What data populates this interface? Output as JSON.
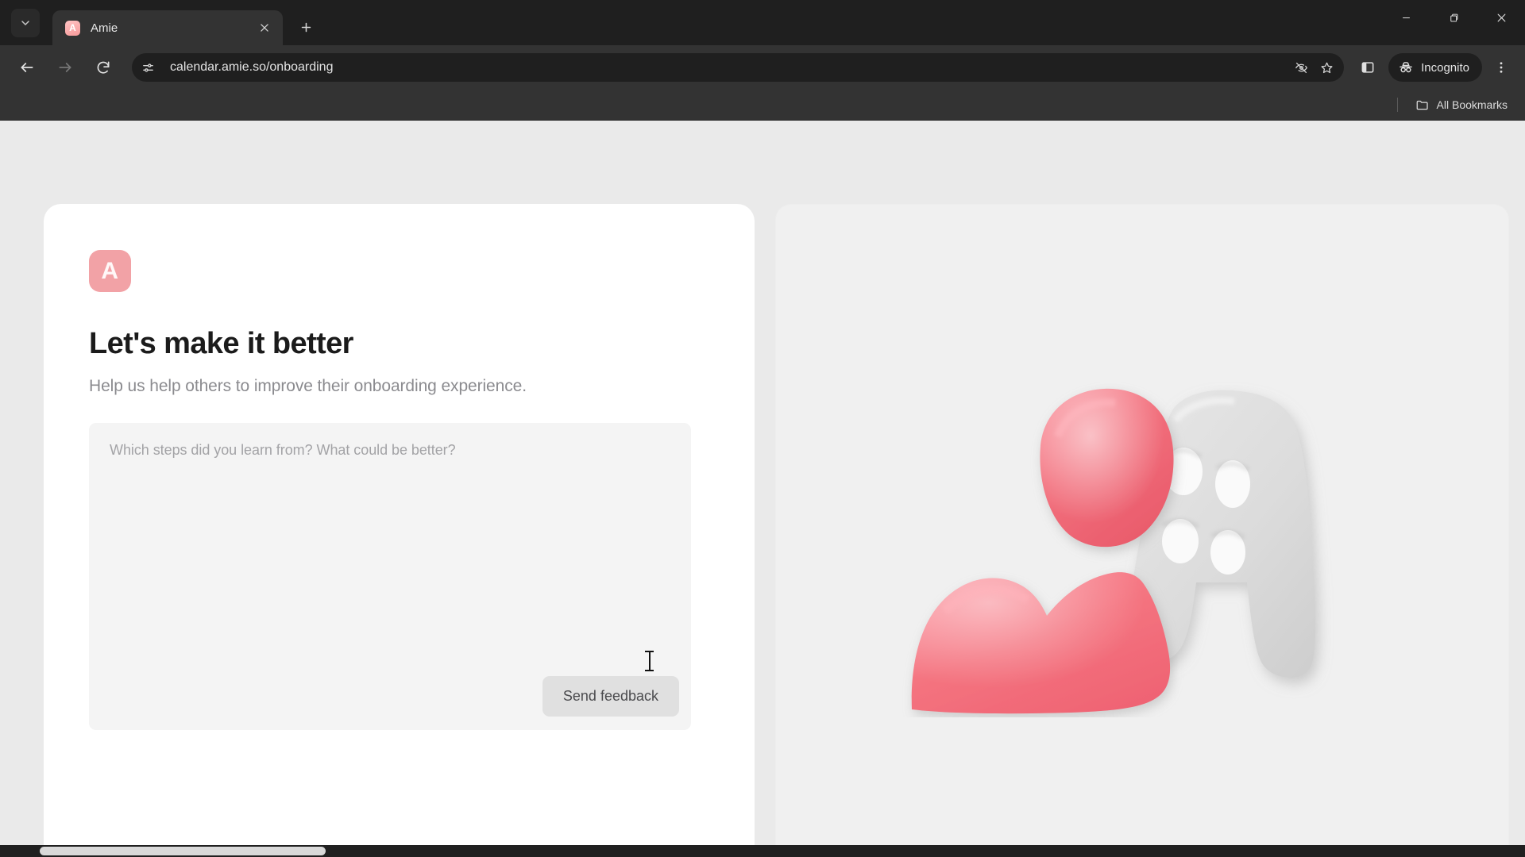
{
  "browser": {
    "tab": {
      "title": "Amie",
      "favicon_letter": "A",
      "favicon_name": "amie-favicon"
    },
    "new_tab_label": "+",
    "url": "calendar.amie.so/onboarding",
    "profile_chip": "Incognito",
    "bookmarks_label": "All Bookmarks",
    "icons": {
      "tab_search": "chevron-down-icon",
      "tab_close": "close-icon",
      "new_tab": "plus-icon",
      "back": "back-arrow-icon",
      "forward": "forward-arrow-icon",
      "reload": "reload-icon",
      "site_info": "site-settings-icon",
      "tracking": "eye-off-icon",
      "bookmark": "star-icon",
      "side_panel": "side-panel-icon",
      "incognito": "incognito-icon",
      "menu": "three-dot-menu-icon",
      "folder": "folder-icon",
      "minimize": "minimize-icon",
      "maximize": "maximize-icon",
      "close_window": "window-close-icon"
    }
  },
  "page": {
    "logo_letter": "A",
    "title": "Let's make it better",
    "subtitle": "Help us help others to improve their onboarding experience.",
    "feedback": {
      "placeholder": "Which steps did you learn from? What could be better?",
      "value": "",
      "submit_label": "Send feedback"
    },
    "illustration": {
      "name": "amie-person-letter-a-illustration",
      "person_color": "#f2727f",
      "letter_color": "#dadada"
    },
    "colors": {
      "brand_pink": "#f2a2a6",
      "page_background": "#eaeaea",
      "card_background": "#ffffff",
      "panel_background": "#f0f0f0",
      "input_background": "#f4f4f4",
      "button_background": "#e0e0e0"
    }
  }
}
